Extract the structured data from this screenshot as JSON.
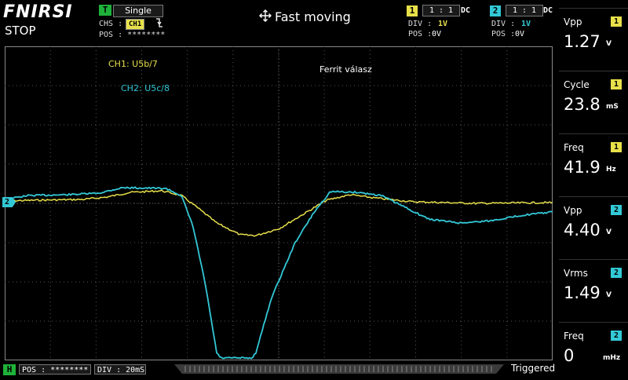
{
  "header": {
    "brand": "FNIRSI",
    "run_state": "STOP",
    "trigger": {
      "badge": "T",
      "mode": "Single",
      "chs_label": "CHS :",
      "chs_value": "CH1",
      "edge_icon": "falling-edge-icon",
      "pos_label": "POS : ********"
    },
    "mode_title": "Fast moving",
    "mode_icon": "move-arrows-icon",
    "ch1": {
      "badge": "1",
      "ratio": "1 : 1",
      "coupling": "DC",
      "div_label": "DIV :",
      "div_value": "1V",
      "pos_label": "POS :",
      "pos_value": "0V",
      "color": "#e8e04a"
    },
    "ch2": {
      "badge": "2",
      "ratio": "1 : 1",
      "coupling": "DC",
      "div_label": "DIV :",
      "div_value": "1V",
      "pos_label": "POS :",
      "pos_value": "0V",
      "color": "#33c8d6"
    }
  },
  "plot": {
    "labels": {
      "ch1": "CH1: U5b/7",
      "ch2": "CH2: U5c/8",
      "annotation": "Ferrit válasz"
    },
    "ch2_marker": "2"
  },
  "measurements": [
    {
      "label": "Vpp",
      "channel": "1",
      "value": "1.27",
      "unit": "V"
    },
    {
      "label": "Cycle",
      "channel": "1",
      "value": "23.8",
      "unit": "mS"
    },
    {
      "label": "Freq",
      "channel": "1",
      "value": "41.9",
      "unit": "Hz"
    },
    {
      "label": "Vpp",
      "channel": "2",
      "value": "4.40",
      "unit": "V"
    },
    {
      "label": "Vrms",
      "channel": "2",
      "value": "1.49",
      "unit": "V"
    },
    {
      "label": "Freq",
      "channel": "2",
      "value": "0",
      "unit": "mHz"
    }
  ],
  "footer": {
    "h_badge": "H",
    "pos": "POS : ********",
    "div": "DIV : 20mS",
    "status": "Triggered"
  }
}
